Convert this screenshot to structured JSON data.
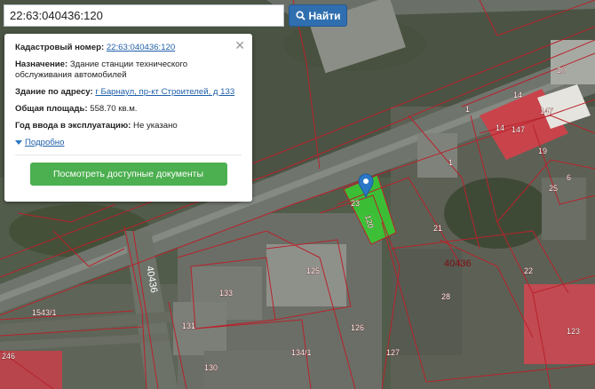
{
  "search": {
    "value": "22:63:040436:120",
    "button_label": "Найти"
  },
  "card": {
    "cadastral_label": "Кадастровый номер:",
    "cadastral_value": "22:63:040436:120",
    "purpose_label": "Назначение:",
    "purpose_value": "Здание станции технического обслуживания автомобилей",
    "address_label": "Здание по адресу:",
    "address_value": "г Барнаул, пр-кт Строителей, д 133",
    "area_label": "Общая площадь:",
    "area_value": "558.70 кв.м.",
    "year_label": "Год ввода в эксплуатацию:",
    "year_value": "Не указано",
    "more_label": "Подробно",
    "docs_button": "Посмотреть доступные документы"
  },
  "map": {
    "quarter_labels": [
      "40436",
      "40436"
    ],
    "parcel_labels": [
      "20",
      "14",
      "147",
      "14",
      "147",
      "1",
      "19",
      "25",
      "6",
      "1",
      "21",
      "22",
      "125",
      "133",
      "28",
      "126",
      "131",
      "134/1",
      "127",
      "130",
      "123",
      "1543/1",
      "246"
    ],
    "selected_labels": [
      "120",
      "23"
    ],
    "colors": {
      "parcel_line": "#b8222c",
      "selected_fill": "#39c734",
      "marker": "#2a78c5"
    }
  }
}
